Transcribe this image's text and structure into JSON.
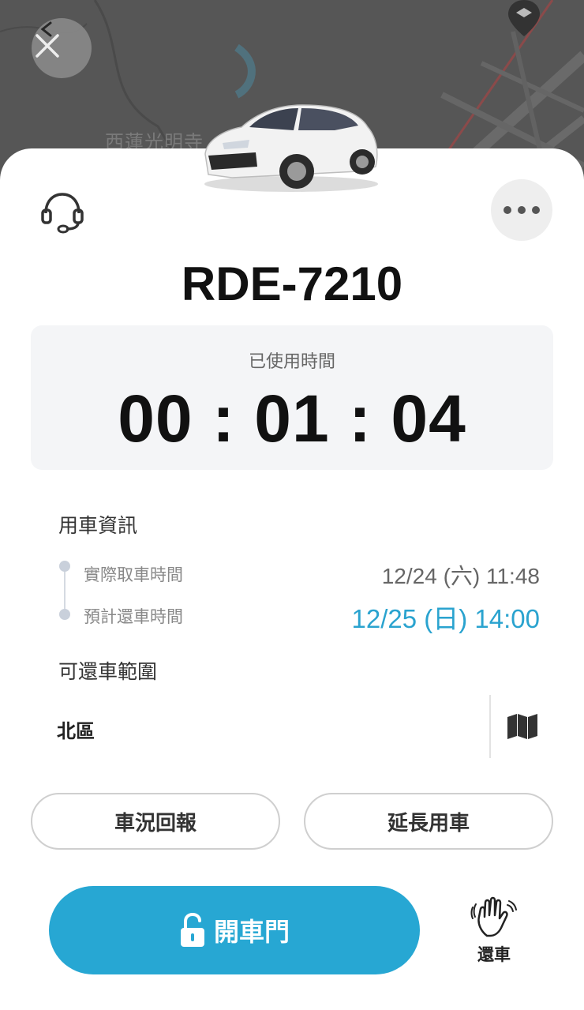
{
  "map": {
    "place_label": "西蓮光明寺"
  },
  "vehicle": {
    "plate": "RDE-7210"
  },
  "timer": {
    "label": "已使用時間",
    "value": "00 : 01 : 04"
  },
  "rental_info": {
    "title": "用車資訊",
    "pickup_label": "實際取車時間",
    "pickup_value": "12/24 (六) 11:48",
    "return_label": "預計還車時間",
    "return_value": "12/25 (日) 14:00"
  },
  "return_area": {
    "title": "可還車範圍",
    "value": "北區"
  },
  "actions": {
    "report_label": "車況回報",
    "extend_label": "延長用車",
    "unlock_label": "開車門",
    "return_label": "還車"
  },
  "colors": {
    "accent": "#27a7d3",
    "return_time": "#2aa3cf",
    "map_bg": "#565656"
  },
  "icons": [
    "close-icon",
    "map-pin-icon",
    "headset-icon",
    "more-icon",
    "folded-map-icon",
    "unlock-icon",
    "wave-hand-icon"
  ]
}
